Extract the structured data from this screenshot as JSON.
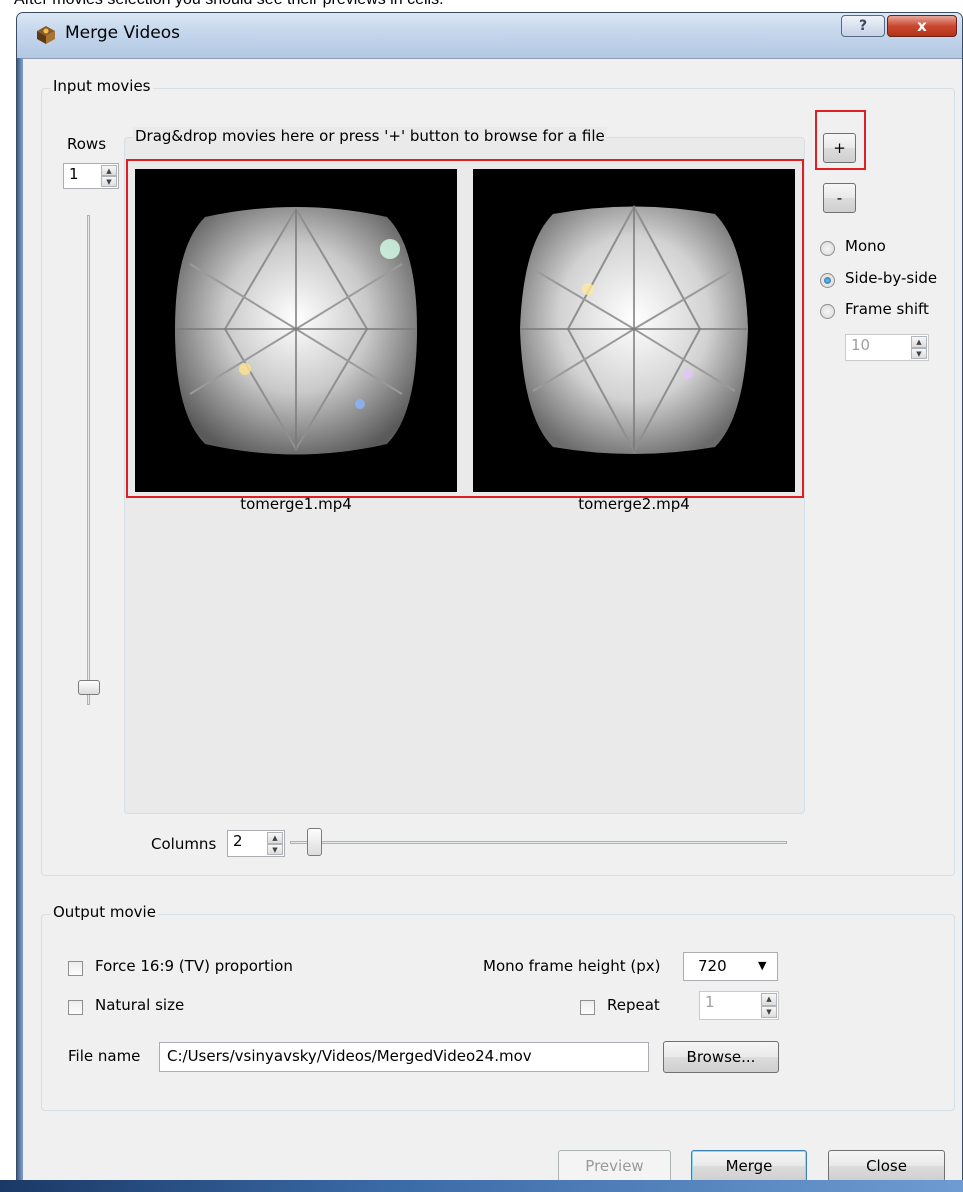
{
  "caption": "After movies selection you should see their previews in cells.",
  "window": {
    "title": "Merge Videos",
    "help_label": "?",
    "close_label": "x"
  },
  "input": {
    "group_title": "Input movies",
    "rows_label": "Rows",
    "rows_value": "1",
    "dropzone_title": "Drag&drop movies here or press '+' button to browse for a file",
    "add_label": "+",
    "remove_label": "-",
    "modes": [
      {
        "label": "Mono",
        "checked": false
      },
      {
        "label": "Side-by-side",
        "checked": true
      },
      {
        "label": "Frame shift",
        "checked": false
      }
    ],
    "frame_shift_value": "10",
    "thumbnails": [
      {
        "filename": "tomerge1.mp4"
      },
      {
        "filename": "tomerge2.mp4"
      }
    ],
    "columns_label": "Columns",
    "columns_value": "2"
  },
  "output": {
    "group_title": "Output movie",
    "force_label": "Force 16:9 (TV) proportion",
    "natural_label": "Natural size",
    "mono_height_label": "Mono frame height (px)",
    "mono_height_value": "720",
    "repeat_label": "Repeat",
    "repeat_value": "1",
    "filename_label": "File name",
    "filename_value": "C:/Users/vsinyavsky/Videos/MergedVideo24.mov",
    "browse_label": "Browse..."
  },
  "footer": {
    "preview_label": "Preview",
    "merge_label": "Merge",
    "close_label": "Close"
  },
  "colors": {
    "highlight": "#e02020",
    "titlebar": "#c3d6ec",
    "dialog_bg": "#f0f0f0"
  }
}
